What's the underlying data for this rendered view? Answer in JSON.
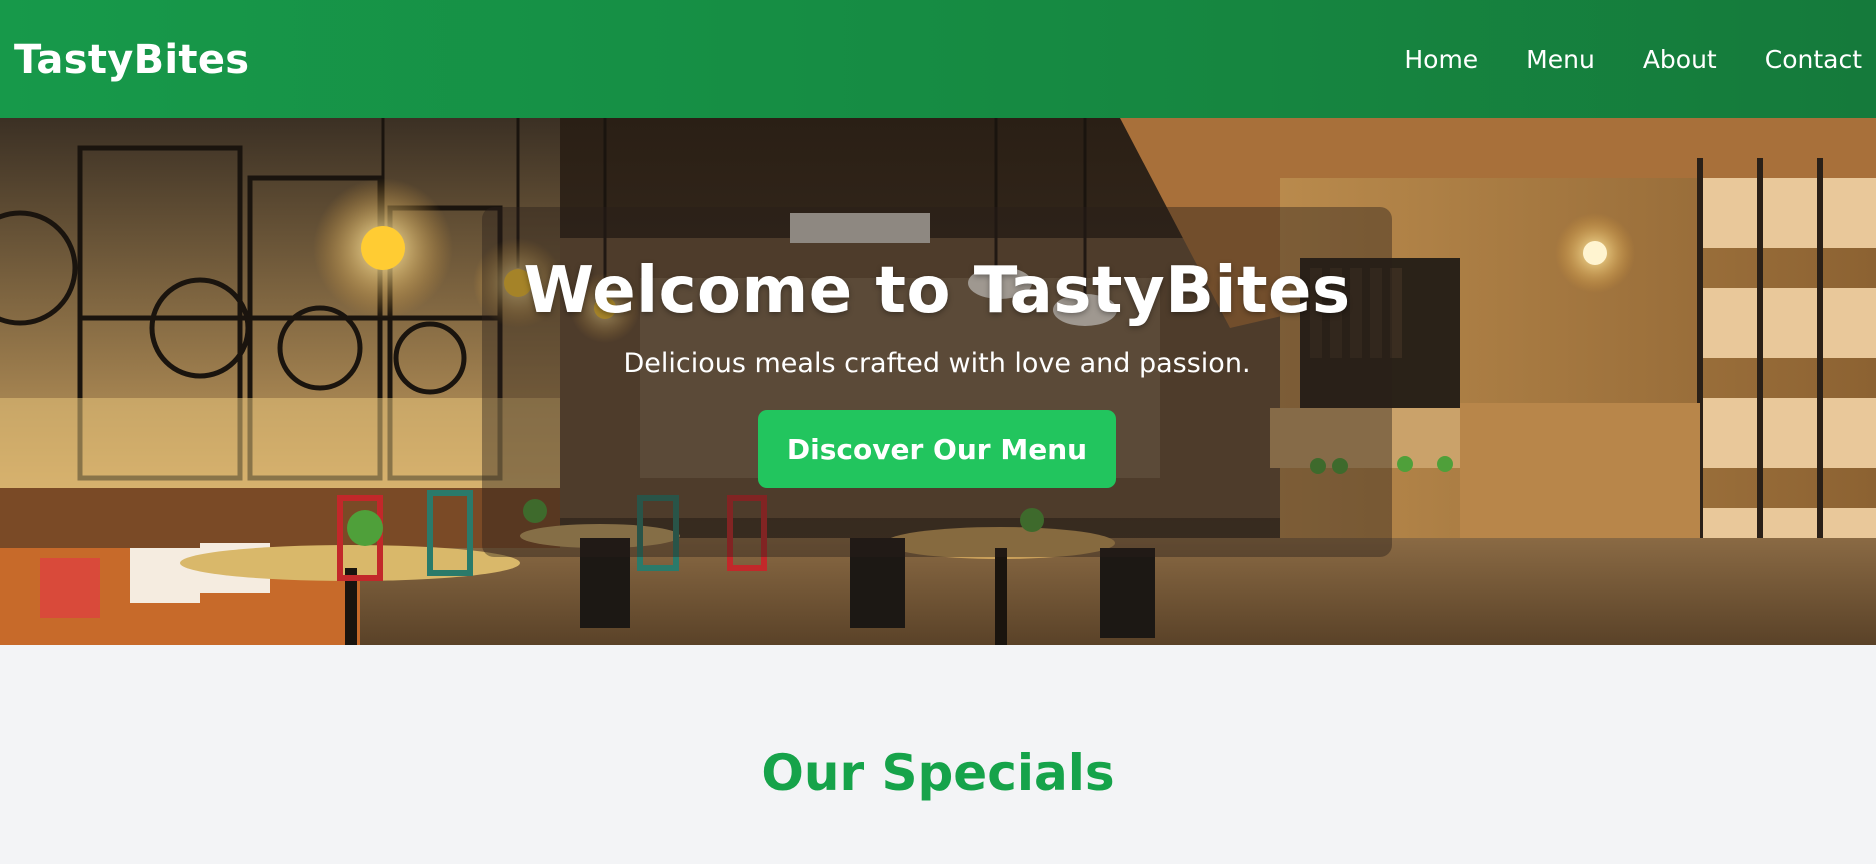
{
  "header": {
    "brand": "TastyBites",
    "nav": [
      {
        "label": "Home"
      },
      {
        "label": "Menu"
      },
      {
        "label": "About"
      },
      {
        "label": "Contact"
      }
    ]
  },
  "hero": {
    "title": "Welcome to TastyBites",
    "subtitle": "Delicious meals crafted with love and passion.",
    "cta_label": "Discover Our Menu",
    "image": "restaurant-interior-photo"
  },
  "specials": {
    "heading": "Our Specials"
  },
  "colors": {
    "header_green": "#17994a",
    "cta_green": "#22c55e",
    "heading_green": "#16a34a",
    "page_background": "#f3f4f6"
  }
}
